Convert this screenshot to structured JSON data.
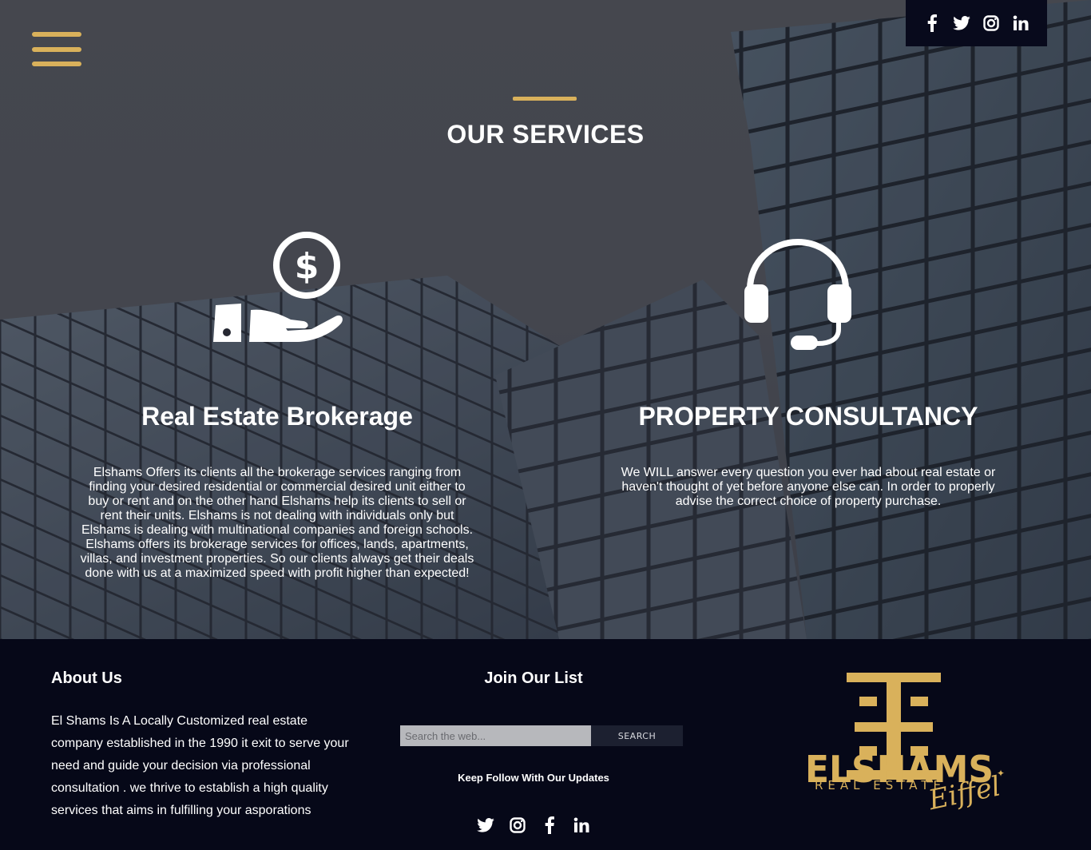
{
  "header": {
    "menu_icon": "hamburger-menu-icon",
    "social": [
      {
        "name": "facebook-icon"
      },
      {
        "name": "twitter-icon"
      },
      {
        "name": "instagram-icon"
      },
      {
        "name": "linkedin-icon"
      }
    ]
  },
  "services": {
    "title": "OUR SERVICES",
    "items": [
      {
        "icon": "money-hand-icon",
        "heading": "Real Estate Brokerage",
        "text": "Elshams Offers its clients all the brokerage services ranging from finding your desired residential or commercial desired unit either to buy or rent and on the other hand Elshams help its clients to sell or rent their units. Elshams is not dealing with individuals only but Elshams is dealing with multinational companies and foreign schools. Elshams offers its brokerage services for offices, lands, apartments, villas, and investment properties. So our clients always get their deals done with us at a maximized speed with profit higher than expected!"
      },
      {
        "icon": "headset-icon",
        "heading": "PROPERTY CONSULTANCY",
        "text": "We WILL answer every question you ever had about real estate or haven't thought of yet before anyone else can. In order to properly advise the correct choice of property purchase."
      }
    ]
  },
  "footer": {
    "about": {
      "heading": "About Us",
      "text": "El Shams Is A Locally Customized real estate company established in the 1990 it exit to serve your need and guide your decision via professional consultation . we thrive to establish a high quality services that aims in fulfilling your asporations"
    },
    "join": {
      "heading": "Join Our List",
      "search_placeholder": "Search the web...",
      "search_button": "SEARCH",
      "follow_text": "Keep Follow With Our Updates"
    },
    "logo": {
      "brand": "ELSHAMS",
      "tagline": "REAL ESTATE",
      "script": "Eiffel"
    }
  },
  "colors": {
    "gold": "#d9b15b",
    "dark": "#060818"
  }
}
